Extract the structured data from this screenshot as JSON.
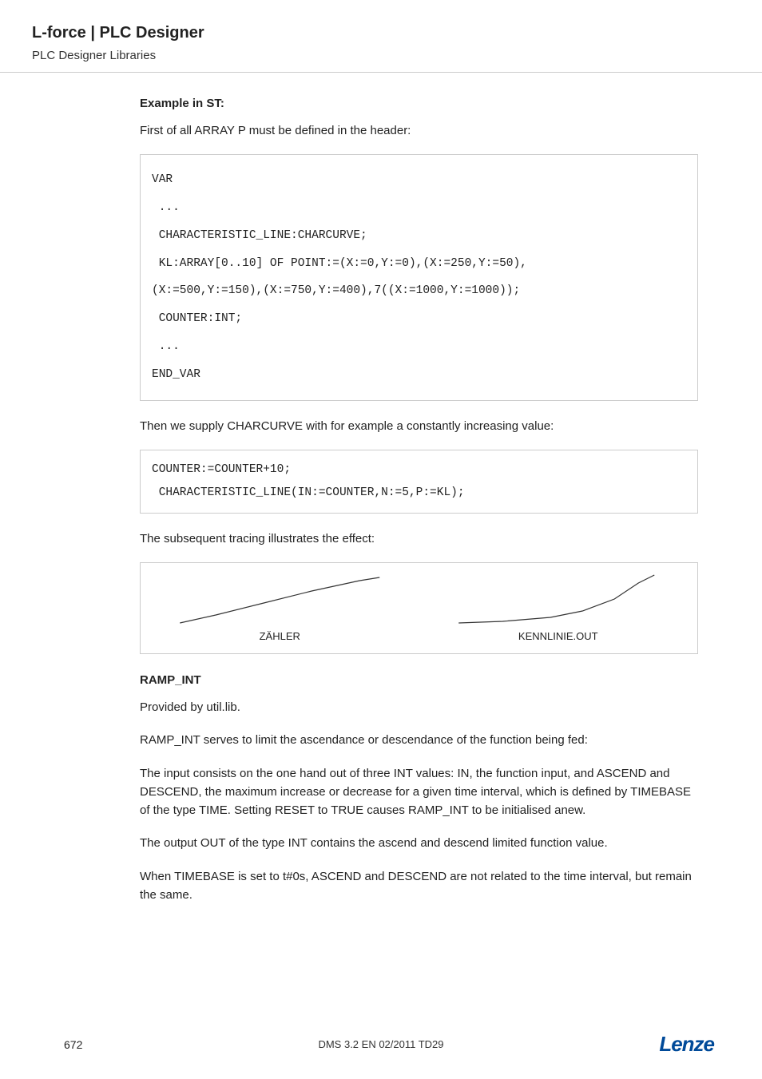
{
  "header": {
    "title": "L-force | PLC Designer",
    "subtitle": "PLC Designer Libraries"
  },
  "section1": {
    "heading": "Example in ST:",
    "intro": "First of all ARRAY P must be defined in the header:",
    "code": "VAR\n ...\n CHARACTERISTIC_LINE:CHARCURVE;\n KL:ARRAY[0..10] OF POINT:=(X:=0,Y:=0),(X:=250,Y:=50),\n(X:=500,Y:=150),(X:=750,Y:=400),7((X:=1000,Y:=1000));\n COUNTER:INT;\n ...\nEND_VAR",
    "after": "Then we supply CHARCURVE with for example a constantly increasing value:",
    "code2": "COUNTER:=COUNTER+10;\n CHARACTERISTIC_LINE(IN:=COUNTER,N:=5,P:=KL);",
    "tracing": "The subsequent tracing illustrates the effect:"
  },
  "figure": {
    "label1": "ZÄHLER",
    "label2": "KENNLINIE.OUT"
  },
  "section2": {
    "heading": "RAMP_INT",
    "p1": "Provided by util.lib.",
    "p2": "RAMP_INT serves to limit the ascendance or descendance of the function being fed:",
    "p3": "The input consists on the one hand out of three INT values: IN, the function input, and ASCEND and DESCEND, the maximum increase or decrease for a given time interval, which is defined by TIMEBASE of the type TIME. Setting RESET to TRUE causes RAMP_INT to be initialised anew.",
    "p4": "The output OUT of the type INT contains the ascend and descend limited function value.",
    "p5": "When TIMEBASE is set to t#0s, ASCEND and DESCEND are not related to the time interval, but remain the same."
  },
  "footer": {
    "page": "672",
    "center": "DMS 3.2 EN 02/2011 TD29",
    "logo": "Lenze"
  }
}
